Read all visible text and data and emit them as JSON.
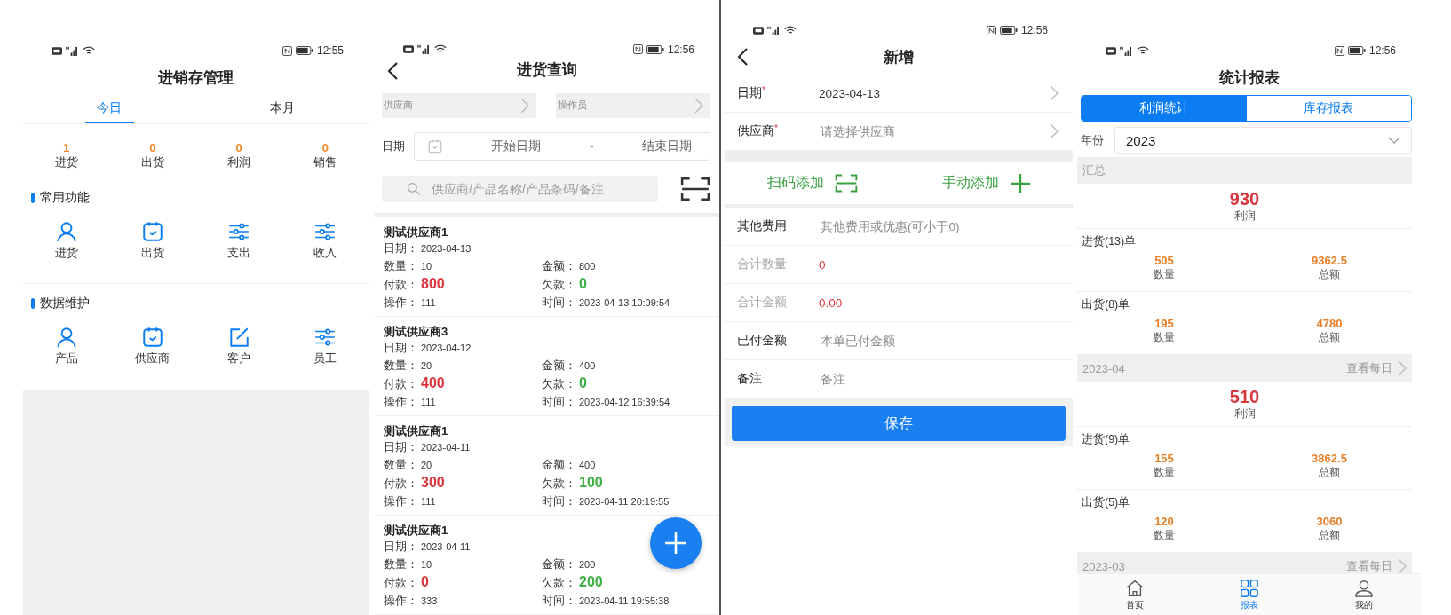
{
  "home": {
    "status_bar": {
      "time": "12:55"
    },
    "title": "进销存管理",
    "tabs": [
      {
        "label": "今日",
        "selected": true
      },
      {
        "label": "本月",
        "selected": false
      }
    ],
    "stats": [
      {
        "value": "1",
        "label": "进货"
      },
      {
        "value": "0",
        "label": "出货"
      },
      {
        "value": "0",
        "label": "利润"
      },
      {
        "value": "0",
        "label": "销售"
      }
    ],
    "sections": [
      {
        "title": "常用功能",
        "items": [
          {
            "label": "进货",
            "kind": "person"
          },
          {
            "label": "出货",
            "kind": "calendar"
          },
          {
            "label": "支出",
            "kind": "sliders"
          },
          {
            "label": "收入",
            "kind": "sliders"
          }
        ]
      },
      {
        "title": "数据维护",
        "items": [
          {
            "label": "产品",
            "kind": "person"
          },
          {
            "label": "供应商",
            "kind": "calendar"
          },
          {
            "label": "客户",
            "kind": "edit"
          },
          {
            "label": "员工",
            "kind": "sliders"
          }
        ]
      }
    ]
  },
  "purchase_query": {
    "status_bar": {
      "time": "12:56"
    },
    "title": "进货查询",
    "pickers": [
      {
        "placeholder": "供应商"
      },
      {
        "placeholder": "操作员"
      }
    ],
    "date_filter": {
      "label": "日期",
      "start_placeholder": "开始日期",
      "separator": "-",
      "end_placeholder": "结束日期"
    },
    "search": {
      "placeholder": "供应商/产品名称/产品条码/备注"
    },
    "records": [
      {
        "supplier": "测试供应商1",
        "date_label": "日期：",
        "date": "2023-04-13",
        "fields": [
          {
            "label": "数量：",
            "value": "10",
            "kind": "plain"
          },
          {
            "label": "金额：",
            "value": "800",
            "kind": "plain"
          },
          {
            "label": "付款：",
            "value": "800",
            "kind": "paid"
          },
          {
            "label": "欠款：",
            "value": "0",
            "kind": "debt"
          },
          {
            "label": "操作：",
            "value": "111",
            "kind": "plain"
          },
          {
            "label": "时间：",
            "value": "2023-04-13 10:09:54",
            "kind": "plain"
          }
        ]
      },
      {
        "supplier": "测试供应商3",
        "date_label": "日期：",
        "date": "2023-04-12",
        "fields": [
          {
            "label": "数量：",
            "value": "20",
            "kind": "plain"
          },
          {
            "label": "金额：",
            "value": "400",
            "kind": "plain"
          },
          {
            "label": "付款：",
            "value": "400",
            "kind": "paid"
          },
          {
            "label": "欠款：",
            "value": "0",
            "kind": "debt"
          },
          {
            "label": "操作：",
            "value": "111",
            "kind": "plain"
          },
          {
            "label": "时间：",
            "value": "2023-04-12 16:39:54",
            "kind": "plain"
          }
        ]
      },
      {
        "supplier": "测试供应商1",
        "date_label": "日期：",
        "date": "2023-04-11",
        "fields": [
          {
            "label": "数量：",
            "value": "20",
            "kind": "plain"
          },
          {
            "label": "金额：",
            "value": "400",
            "kind": "plain"
          },
          {
            "label": "付款：",
            "value": "300",
            "kind": "paid"
          },
          {
            "label": "欠款：",
            "value": "100",
            "kind": "debt"
          },
          {
            "label": "操作：",
            "value": "111",
            "kind": "plain"
          },
          {
            "label": "时间：",
            "value": "2023-04-11 20:19:55",
            "kind": "plain"
          }
        ]
      },
      {
        "supplier": "测试供应商1",
        "date_label": "日期：",
        "date": "2023-04-11",
        "fields": [
          {
            "label": "数量：",
            "value": "10",
            "kind": "plain"
          },
          {
            "label": "金额：",
            "value": "200",
            "kind": "plain"
          },
          {
            "label": "付款：",
            "value": "0",
            "kind": "paid"
          },
          {
            "label": "欠款：",
            "value": "200",
            "kind": "debt"
          },
          {
            "label": "操作：",
            "value": "333",
            "kind": "plain"
          },
          {
            "label": "时间：",
            "value": "2023-04-11 19:55:38",
            "kind": "plain"
          }
        ]
      }
    ]
  },
  "new_entry": {
    "status_bar": {
      "time": "12:56"
    },
    "title": "新增",
    "top_rows": [
      {
        "label": "日期",
        "mark": "*",
        "value": "2023-04-13",
        "chevron": true,
        "disabled": false
      },
      {
        "label": "供应商",
        "mark": "*",
        "placeholder": "请选择供应商",
        "chevron": true,
        "disabled": false
      }
    ],
    "actions": [
      {
        "label": "扫码添加",
        "kind": "scan"
      },
      {
        "label": "手动添加",
        "kind": "plus"
      }
    ],
    "rows": [
      {
        "label": "其他费用",
        "placeholder": "其他费用或优惠(可小于0)",
        "disabled": false
      },
      {
        "label": "合计数量",
        "value": "0",
        "disabled": true
      },
      {
        "label": "合计金额",
        "value": "0.00",
        "disabled": true
      },
      {
        "label": "已付金额",
        "placeholder": "本单已付金额",
        "disabled": false
      },
      {
        "label": "备注",
        "placeholder": "备注",
        "disabled": false
      }
    ],
    "save_button": "保存"
  },
  "report": {
    "status_bar": {
      "time": "12:56"
    },
    "title": "统计报表",
    "segments": [
      {
        "label": "利润统计",
        "selected": true
      },
      {
        "label": "库存报表",
        "selected": false
      }
    ],
    "year": {
      "label": "年份",
      "value": "2023"
    },
    "groups": [
      {
        "header": "汇总",
        "profit": {
          "value": "930",
          "label": "利润"
        },
        "blocks": [
          {
            "title": "进货(13)单",
            "items": [
              {
                "value": "505",
                "label": "数量"
              },
              {
                "value": "9362.5",
                "label": "总额"
              }
            ]
          },
          {
            "title": "出货(8)单",
            "items": [
              {
                "value": "195",
                "label": "数量"
              },
              {
                "value": "4780",
                "label": "总额"
              }
            ]
          }
        ]
      },
      {
        "header": "2023-04",
        "link": "查看每日",
        "profit": {
          "value": "510",
          "label": "利润"
        },
        "blocks": [
          {
            "title": "进货(9)单",
            "items": [
              {
                "value": "155",
                "label": "数量"
              },
              {
                "value": "3862.5",
                "label": "总额"
              }
            ]
          },
          {
            "title": "出货(5)单",
            "items": [
              {
                "value": "120",
                "label": "数量"
              },
              {
                "value": "3060",
                "label": "总额"
              }
            ]
          }
        ]
      },
      {
        "header": "2023-03",
        "link": "查看每日"
      }
    ],
    "nav": [
      {
        "label": "首页",
        "kind": "home",
        "selected": false
      },
      {
        "label": "报表",
        "kind": "grid",
        "selected": true
      },
      {
        "label": "我的",
        "kind": "user",
        "selected": false
      }
    ]
  }
}
